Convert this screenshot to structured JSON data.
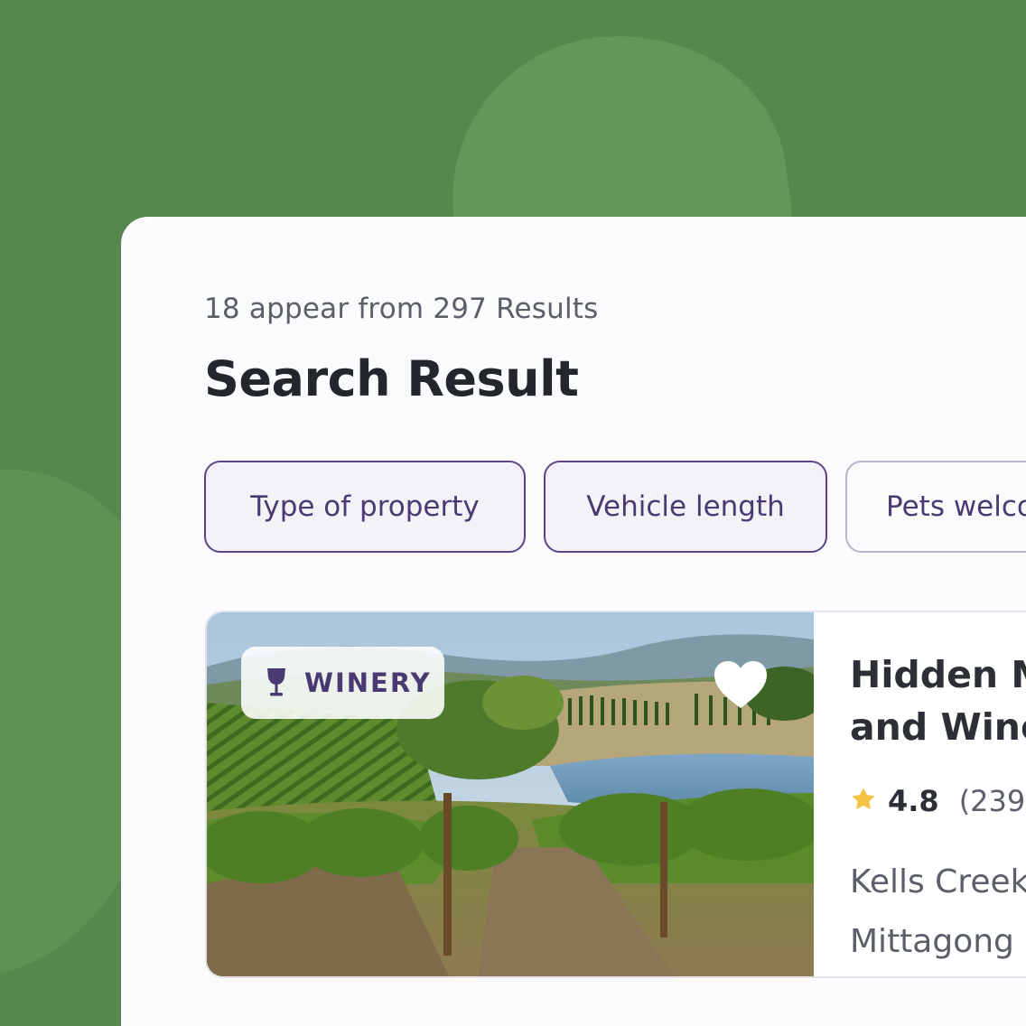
{
  "results": {
    "summary": "18 appear from 297 Results",
    "heading": "Search Result"
  },
  "filters": [
    {
      "label": "Type of property",
      "active": true
    },
    {
      "label": "Vehicle length",
      "active": true
    },
    {
      "label": "Pets welco",
      "active": false
    }
  ],
  "listing": {
    "badge_label": "WINERY",
    "badge_icon": "wine-glass-icon",
    "favorite_icon": "heart-icon",
    "name_line1": "Hidden M",
    "name_line2": "and Wine",
    "rating": "4.8",
    "reviews": "(239",
    "rating_icon": "star-icon",
    "address_line1": "Kells Creek",
    "address_line2": "Mittagong"
  },
  "colors": {
    "background": "#57874c",
    "accent": "#4a3a74",
    "star": "#f6c244"
  }
}
